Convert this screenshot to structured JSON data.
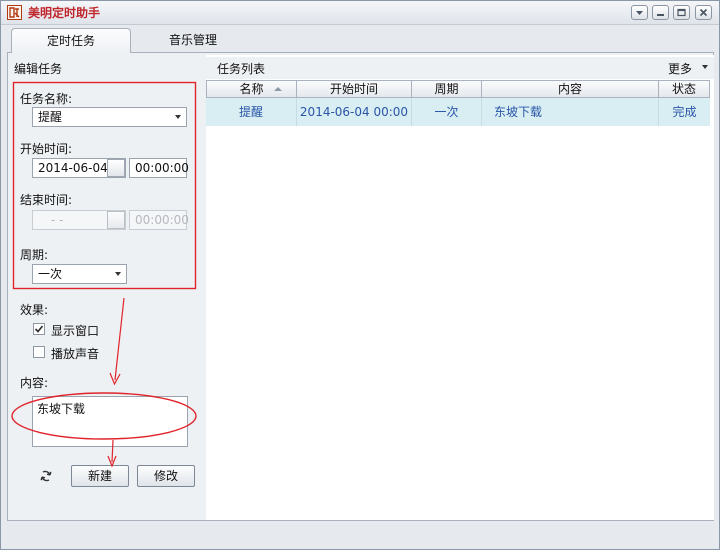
{
  "window": {
    "title": "美明定时助手",
    "icon": "app-logo-icon",
    "controls": [
      "dropdown-icon",
      "minimize-icon",
      "restore-icon",
      "close-icon"
    ]
  },
  "tabs": [
    {
      "label": "定时任务",
      "active": true
    },
    {
      "label": "音乐管理",
      "active": false
    }
  ],
  "edit_panel": {
    "title": "编辑任务",
    "task_name_label": "任务名称:",
    "task_name_value": "提醒",
    "start_label": "开始时间:",
    "start_date": "2014-06-04",
    "start_time": "00:00:00",
    "end_label": "结束时间:",
    "end_date": "  -  -",
    "end_time": "00:00:00",
    "period_label": "周期:",
    "period_value": "一次",
    "effect_label": "效果:",
    "show_window_label": "显示窗口",
    "show_window_checked": true,
    "play_sound_label": "播放声音",
    "play_sound_checked": false,
    "content_label": "内容:",
    "content_value": "东坡下载",
    "refresh_icon": "refresh-icon",
    "new_button": "新建",
    "modify_button": "修改"
  },
  "task_list": {
    "title": "任务列表",
    "more_label": "更多",
    "columns": [
      "名称",
      "开始时间",
      "周期",
      "内容",
      "状态"
    ],
    "rows": [
      {
        "name": "提醒",
        "start": "2014-06-04 00:00",
        "period": "一次",
        "content": "东坡下载",
        "status": "完成"
      }
    ]
  },
  "colors": {
    "title_red": "#c0252b",
    "annotation_red": "#e0242c",
    "row_highlight": "#d8eef3",
    "row_text": "#2a55a7"
  }
}
